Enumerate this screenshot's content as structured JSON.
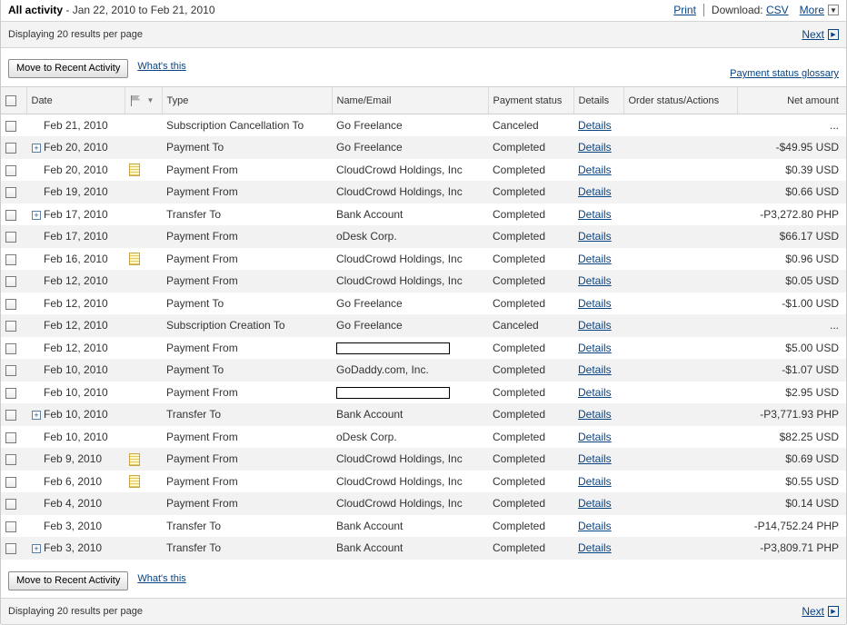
{
  "header": {
    "title": "All activity",
    "date_range": " - Jan 22, 2010 to Feb 21, 2010",
    "print_label": "Print",
    "download_label": "Download:",
    "csv_label": "CSV",
    "more_label": "More"
  },
  "paging": {
    "displaying_label": "Displaying 20 results per page",
    "next_label": "Next"
  },
  "actions": {
    "move_button": "Move to Recent Activity",
    "whats_this": "What's this",
    "glossary_link": "Payment status glossary"
  },
  "columns": {
    "date": "Date",
    "type": "Type",
    "name_email": "Name/Email",
    "payment_status": "Payment status",
    "details": "Details",
    "order_status": "Order status/Actions",
    "net_amount": "Net amount"
  },
  "icons": {
    "expand": "plus-box-icon",
    "note": "note-icon",
    "flag": "flag-icon",
    "checkbox": "checkbox-icon"
  },
  "rows": [
    {
      "expand": false,
      "note": false,
      "date": "Feb 21, 2010",
      "type": "Subscription Cancellation To",
      "name": "Go Freelance",
      "redacted": false,
      "status": "Canceled",
      "details": "Details",
      "amount": "..."
    },
    {
      "expand": true,
      "note": false,
      "date": "Feb 20, 2010",
      "type": "Payment To",
      "name": "Go Freelance",
      "redacted": false,
      "status": "Completed",
      "details": "Details",
      "amount": "-$49.95 USD"
    },
    {
      "expand": false,
      "note": true,
      "date": "Feb 20, 2010",
      "type": "Payment From",
      "name": "CloudCrowd Holdings, Inc",
      "redacted": false,
      "status": "Completed",
      "details": "Details",
      "amount": "$0.39 USD"
    },
    {
      "expand": false,
      "note": false,
      "date": "Feb 19, 2010",
      "type": "Payment From",
      "name": "CloudCrowd Holdings, Inc",
      "redacted": false,
      "status": "Completed",
      "details": "Details",
      "amount": "$0.66 USD"
    },
    {
      "expand": true,
      "note": false,
      "date": "Feb 17, 2010",
      "type": "Transfer To",
      "name": "Bank Account",
      "redacted": false,
      "status": "Completed",
      "details": "Details",
      "amount": "-P3,272.80 PHP"
    },
    {
      "expand": false,
      "note": false,
      "date": "Feb 17, 2010",
      "type": "Payment From",
      "name": "oDesk Corp.",
      "redacted": false,
      "status": "Completed",
      "details": "Details",
      "amount": "$66.17 USD"
    },
    {
      "expand": false,
      "note": true,
      "date": "Feb 16, 2010",
      "type": "Payment From",
      "name": "CloudCrowd Holdings, Inc",
      "redacted": false,
      "status": "Completed",
      "details": "Details",
      "amount": "$0.96 USD"
    },
    {
      "expand": false,
      "note": false,
      "date": "Feb 12, 2010",
      "type": "Payment From",
      "name": "CloudCrowd Holdings, Inc",
      "redacted": false,
      "status": "Completed",
      "details": "Details",
      "amount": "$0.05 USD"
    },
    {
      "expand": false,
      "note": false,
      "date": "Feb 12, 2010",
      "type": "Payment To",
      "name": "Go Freelance",
      "redacted": false,
      "status": "Completed",
      "details": "Details",
      "amount": "-$1.00 USD"
    },
    {
      "expand": false,
      "note": false,
      "date": "Feb 12, 2010",
      "type": "Subscription Creation To",
      "name": "Go Freelance",
      "redacted": false,
      "status": "Canceled",
      "details": "Details",
      "amount": "..."
    },
    {
      "expand": false,
      "note": false,
      "date": "Feb 12, 2010",
      "type": "Payment From",
      "name": "",
      "redacted": true,
      "status": "Completed",
      "details": "Details",
      "amount": "$5.00 USD"
    },
    {
      "expand": false,
      "note": false,
      "date": "Feb 10, 2010",
      "type": "Payment To",
      "name": "GoDaddy.com, Inc.",
      "redacted": false,
      "status": "Completed",
      "details": "Details",
      "amount": "-$1.07 USD"
    },
    {
      "expand": false,
      "note": false,
      "date": "Feb 10, 2010",
      "type": "Payment From",
      "name": "",
      "redacted": true,
      "status": "Completed",
      "details": "Details",
      "amount": "$2.95 USD"
    },
    {
      "expand": true,
      "note": false,
      "date": "Feb 10, 2010",
      "type": "Transfer To",
      "name": "Bank Account",
      "redacted": false,
      "status": "Completed",
      "details": "Details",
      "amount": "-P3,771.93 PHP"
    },
    {
      "expand": false,
      "note": false,
      "date": "Feb 10, 2010",
      "type": "Payment From",
      "name": "oDesk Corp.",
      "redacted": false,
      "status": "Completed",
      "details": "Details",
      "amount": "$82.25 USD"
    },
    {
      "expand": false,
      "note": true,
      "date": "Feb 9, 2010",
      "type": "Payment From",
      "name": "CloudCrowd Holdings, Inc",
      "redacted": false,
      "status": "Completed",
      "details": "Details",
      "amount": "$0.69 USD"
    },
    {
      "expand": false,
      "note": true,
      "date": "Feb 6, 2010",
      "type": "Payment From",
      "name": "CloudCrowd Holdings, Inc",
      "redacted": false,
      "status": "Completed",
      "details": "Details",
      "amount": "$0.55 USD"
    },
    {
      "expand": false,
      "note": false,
      "date": "Feb 4, 2010",
      "type": "Payment From",
      "name": "CloudCrowd Holdings, Inc",
      "redacted": false,
      "status": "Completed",
      "details": "Details",
      "amount": "$0.14 USD"
    },
    {
      "expand": false,
      "note": false,
      "date": "Feb 3, 2010",
      "type": "Transfer To",
      "name": "Bank Account",
      "redacted": false,
      "status": "Completed",
      "details": "Details",
      "amount": "-P14,752.24 PHP"
    },
    {
      "expand": true,
      "note": false,
      "date": "Feb 3, 2010",
      "type": "Transfer To",
      "name": "Bank Account",
      "redacted": false,
      "status": "Completed",
      "details": "Details",
      "amount": "-P3,809.71 PHP"
    }
  ]
}
